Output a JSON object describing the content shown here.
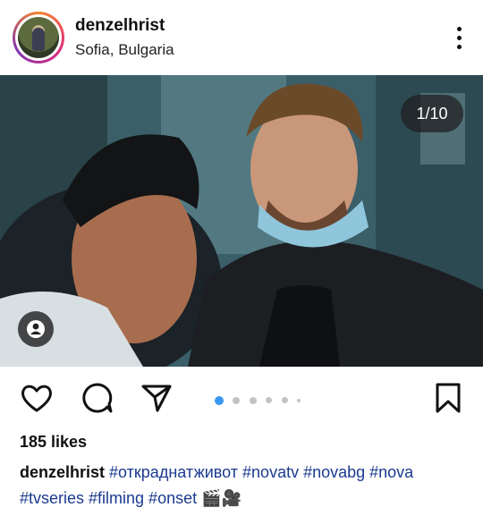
{
  "header": {
    "username": "denzelhrist",
    "location": "Sofia, Bulgaria",
    "avatar_icon": "profile-photo",
    "more_icon": "vertical-ellipsis-icon"
  },
  "post": {
    "counter": "1/10",
    "tag_icon": "person-tag-icon",
    "current_slide": 1,
    "total_slides": 10,
    "visible_dots": 5
  },
  "actions": {
    "like_icon": "heart-icon",
    "comment_icon": "comment-bubble-icon",
    "share_icon": "paper-plane-icon",
    "save_icon": "bookmark-icon"
  },
  "likes": "185 likes",
  "caption": {
    "username": "denzelhrist",
    "text": "#откраднатживот #novatv #novabg #nova #tvseries #filming #onset 🎬🎥"
  },
  "colors": {
    "accent_dot": "#3897f0",
    "hashtag": "#1a3a8f"
  }
}
